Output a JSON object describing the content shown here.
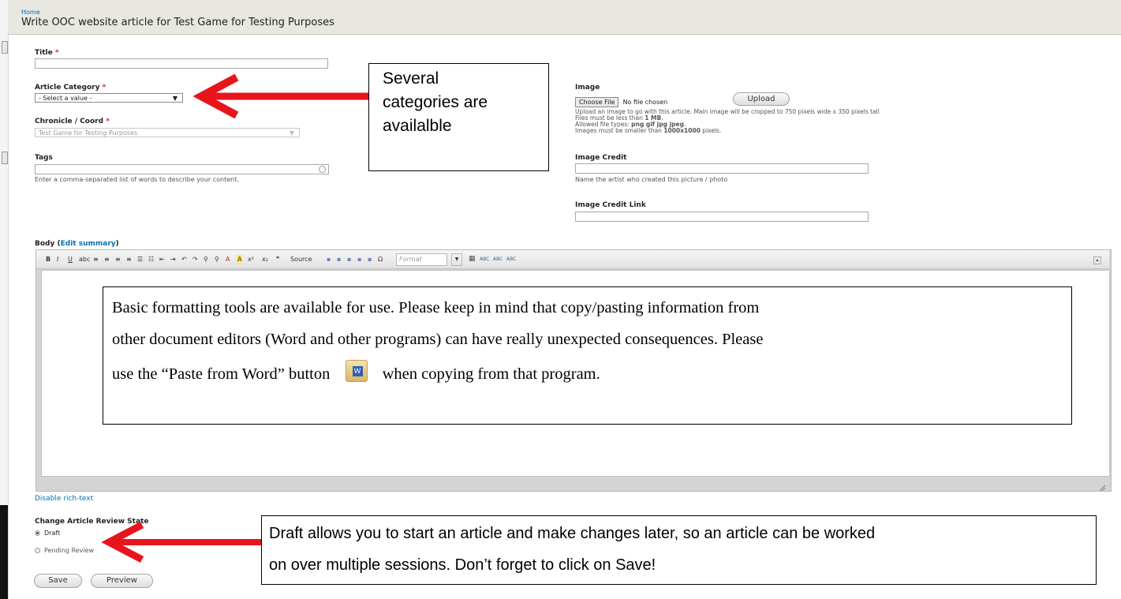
{
  "breadcrumb": "Home",
  "page_title": "Write OOC website article for Test Game for Testing Purposes",
  "form": {
    "title_label": "Title",
    "title_value": "",
    "required_mark": "*",
    "category_label": "Article Category",
    "category_selected": "- Select a value -",
    "chronicle_label": "Chronicle / Coord",
    "chronicle_selected": "Test Game for Testing Purposes",
    "tags_label": "Tags",
    "tags_value": "",
    "tags_desc": "Enter a comma-separated list of words to describe your content.",
    "image_label": "Image",
    "choose_file_label": "Choose File",
    "no_file_text": "No file chosen",
    "upload_label": "Upload",
    "image_desc_1": "Upload an image to go with this article. Main image will be cropped to 750 pixels wide x 350 pixels tall",
    "image_desc_2_pre": "Files must be less than ",
    "image_desc_2_bold": "1 MB",
    "image_desc_2_post": ".",
    "image_desc_3_pre": "Allowed file types: ",
    "image_desc_3_bold": "png gif jpg jpeg",
    "image_desc_3_post": ".",
    "image_desc_4_pre": "Images must be smaller than ",
    "image_desc_4_bold": "1000x1000",
    "image_desc_4_post": " pixels.",
    "image_credit_label": "Image Credit",
    "image_credit_desc": "Name the artist who created this picture / photo",
    "image_credit_link_label": "Image Credit Link",
    "body_label": "Body",
    "edit_summary_link": "Edit summary",
    "disable_richtext_link": "Disable rich-text",
    "review_state_label": "Change Article Review State",
    "review_options": [
      "Draft",
      "Pending Review"
    ],
    "review_selected": "Draft",
    "save_label": "Save",
    "preview_label": "Preview"
  },
  "toolbar": {
    "buttons": [
      "bold-icon",
      "italic-icon",
      "underline-icon",
      "strikethrough-icon",
      "align-left-icon",
      "align-center-icon",
      "align-right-icon",
      "align-justify-icon",
      "bulleted-list-icon",
      "numbered-list-icon",
      "outdent-icon",
      "indent-icon",
      "undo-icon",
      "redo-icon",
      "link-icon",
      "unlink-icon",
      "text-color-icon",
      "bg-color-icon",
      "superscript-icon",
      "subscript-icon",
      "blockquote-icon"
    ],
    "source_label": "Source",
    "format_label": "Format"
  },
  "callouts": {
    "categories": [
      "Several",
      "categories are",
      "availalble"
    ],
    "formatting_line1": "Basic formatting tools are available for use.  Please keep in mind that copy/pasting information from",
    "formatting_line2": "other document editors (Word and other programs) can have really unexpected consequences.  Please",
    "formatting_line3_pre": "use the “Paste from Word” button",
    "formatting_line3_post": "when copying from that program.",
    "draft_line1": "Draft allows you to start an article and make changes later, so an article can be worked",
    "draft_line2": "on over multiple sessions.  Don’t forget to click on Save!"
  },
  "colors": {
    "arrow": "#e8141c",
    "link": "#0071b3",
    "required": "#e02020",
    "header_bg": "#e8e8e1"
  }
}
